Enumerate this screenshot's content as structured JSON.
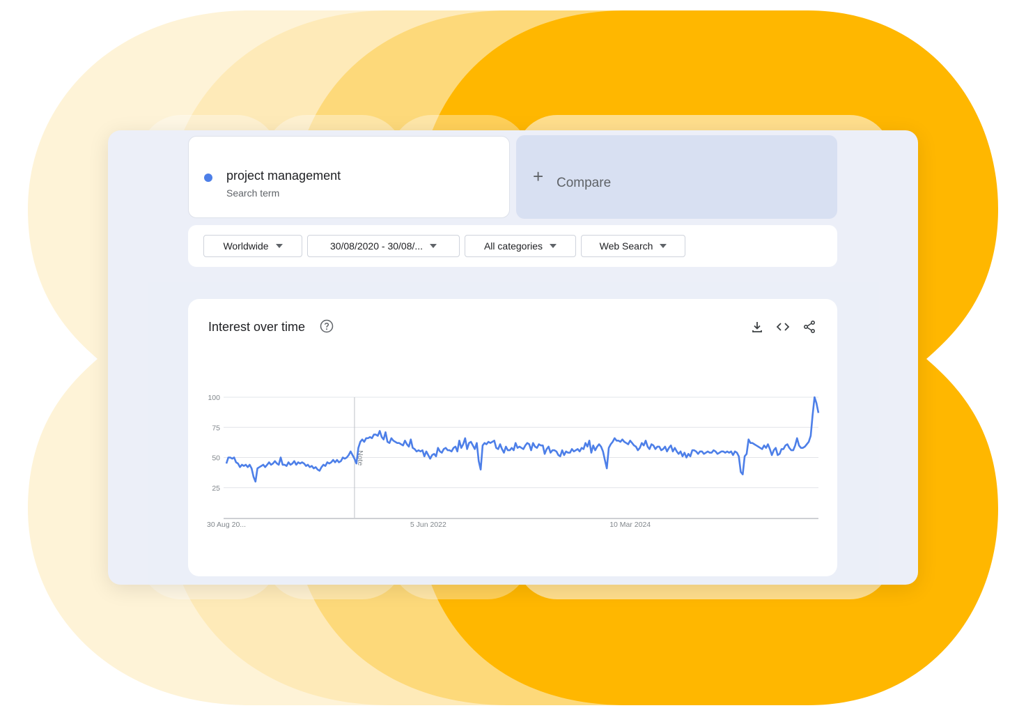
{
  "search": {
    "term": "project management",
    "term_type": "Search term",
    "term_color": "#4d7fe8",
    "compare_label": "Compare"
  },
  "filters": {
    "region": "Worldwide",
    "date_range": "30/08/2020 - 30/08/...",
    "category": "All categories",
    "search_type": "Web Search"
  },
  "chart_header": {
    "title": "Interest over time",
    "help_icon": "help-circle-icon",
    "actions": [
      "download-icon",
      "embed-code-icon",
      "share-icon"
    ]
  },
  "chart_data": {
    "type": "line",
    "title": "Interest over time",
    "series": [
      {
        "name": "project management",
        "color": "#4d7fe8",
        "values": [
          45,
          50,
          50,
          49,
          50,
          46,
          45,
          42,
          44,
          43,
          44,
          42,
          44,
          41,
          34,
          30,
          41,
          42,
          43,
          44,
          42,
          44,
          46,
          44,
          45,
          47,
          45,
          44,
          50,
          44,
          44,
          43,
          46,
          44,
          45,
          47,
          44,
          46,
          45,
          46,
          45,
          43,
          44,
          42,
          43,
          41,
          42,
          40,
          39,
          42,
          44,
          43,
          46,
          45,
          46,
          48,
          46,
          48,
          46,
          47,
          50,
          49,
          50,
          52,
          55,
          52,
          49,
          45,
          58,
          63,
          65,
          63,
          66,
          66,
          67,
          66,
          69,
          69,
          68,
          72,
          67,
          65,
          71,
          63,
          62,
          66,
          64,
          63,
          62,
          62,
          61,
          60,
          64,
          61,
          59,
          65,
          58,
          57,
          55,
          56,
          55,
          56,
          51,
          55,
          52,
          49,
          52,
          53,
          51,
          58,
          55,
          54,
          57,
          58,
          56,
          56,
          55,
          58,
          59,
          55,
          64,
          58,
          61,
          66,
          57,
          62,
          63,
          60,
          57,
          62,
          47,
          40,
          60,
          62,
          61,
          63,
          62,
          63,
          64,
          58,
          57,
          61,
          57,
          54,
          59,
          56,
          56,
          58,
          56,
          62,
          58,
          59,
          58,
          57,
          60,
          62,
          61,
          56,
          62,
          59,
          58,
          61,
          60,
          60,
          53,
          57,
          59,
          54,
          56,
          56,
          55,
          52,
          51,
          56,
          52,
          55,
          54,
          54,
          57,
          55,
          56,
          57,
          55,
          58,
          57,
          62,
          59,
          64,
          54,
          60,
          56,
          59,
          61,
          59,
          55,
          48,
          41,
          58,
          61,
          63,
          66,
          64,
          64,
          63,
          65,
          63,
          62,
          61,
          64,
          62,
          60,
          59,
          56,
          58,
          62,
          60,
          64,
          59,
          57,
          61,
          60,
          57,
          59,
          59,
          56,
          57,
          59,
          55,
          58,
          60,
          55,
          58,
          55,
          53,
          55,
          51,
          54,
          50,
          53,
          51,
          56,
          56,
          55,
          53,
          55,
          55,
          53,
          54,
          55,
          54,
          54,
          56,
          55,
          53,
          54,
          55,
          55,
          54,
          55,
          54,
          55,
          52,
          55,
          54,
          51,
          38,
          36,
          51,
          53,
          65,
          62,
          62,
          61,
          60,
          59,
          58,
          57,
          60,
          58,
          61,
          57,
          52,
          56,
          58,
          52,
          53,
          57,
          57,
          60,
          61,
          58,
          56,
          56,
          60,
          66,
          60,
          58,
          58,
          59,
          61,
          63,
          68,
          85,
          100,
          95,
          87
        ]
      }
    ],
    "x_ticks": [
      "30 Aug 20...",
      "5 Jun 2022",
      "10 Mar 2024"
    ],
    "y_ticks": [
      25,
      50,
      75,
      100
    ],
    "ylim": [
      0,
      100
    ],
    "annotation": "Note",
    "grid": true,
    "legend": "none"
  }
}
